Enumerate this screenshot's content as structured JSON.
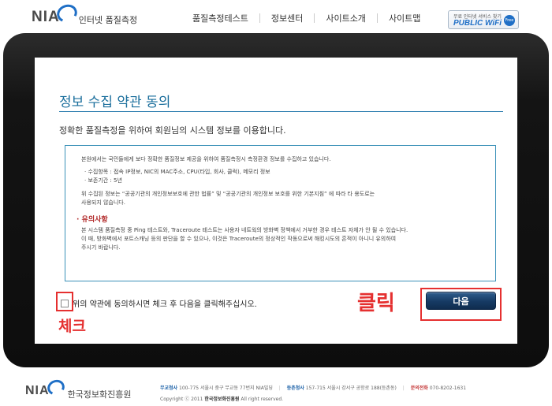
{
  "header": {
    "logo_brand": "NIA",
    "logo_subtitle": "인터넷 품질측정",
    "nav": [
      "품질측정테스트",
      "정보센터",
      "사이트소개",
      "사이트맵"
    ],
    "badge_top": "무료 인터넷 서비스 찾기",
    "badge_main": "PUBLIC WiFi",
    "badge_free": "Free"
  },
  "consent": {
    "title": "정보 수집 약관 동의",
    "subtitle": "정확한 품질측정을 위하여 회원님의 시스템 정보를 이용합니다.",
    "intro": "본원에서는 국민들에게 보다 정확한 품질정보 제공을 위하여 품질측정시 측정환경 정보를 수집하고 있습니다.",
    "items": [
      "· 수집항목 : 접속 IP정보, NIC의 MAC주소, CPU(타입, 회사, 클럭), 메모리 정보",
      "· 보존기간 : 5년"
    ],
    "law_line1": "위 수집된 정보는 “공공기관의 개인정보보호에 관한 법률” 및 “공공기관의 개인정보 보호를 위한 기본지침” 에 따라 타 용도로는",
    "law_line2": "사용되지 않습니다.",
    "caution_title": "· 유의사항",
    "caution_lines": [
      "본 시스템 품질측정 중 Ping 테스트와, Traceroute 테스트는 사용자 네트웍의 방화벽 정책에서 거부한 경우 테스트 자체가 안 될 수 있습니다.",
      "이 때, 방화벽에서 포트스캐닝 등의 판단을 할 수 있으나, 이것은 Traceroute의 정상적인 작동으로써 해킹시도의 흔적이 아니니 유의하여",
      "주시기 바랍니다."
    ],
    "agree_label": "위의 약관에 동의하시면 체크 후 다음을 클릭해주십시오.",
    "next_button": "다음"
  },
  "annotations": {
    "check_label": "체크",
    "click_label": "클릭",
    "highlight_color": "#e53030"
  },
  "footer": {
    "logo_brand": "NIA",
    "org_name": "한국정보화진흥원",
    "hq_label": "무교청사",
    "hq_address": "100-775 서울시 중구 무교동 77번지 NIA빌딩",
    "dg_label": "등촌청사",
    "dg_address": "157-715 서울시 강서구 공항로 188(등촌동)",
    "phone_label": "문의전화",
    "phone": "070-8202-1631",
    "copyright_prefix": "Copyright ⓒ 2011",
    "copyright_org": "한국정보화진흥원",
    "copyright_suffix": "All right reserved."
  }
}
